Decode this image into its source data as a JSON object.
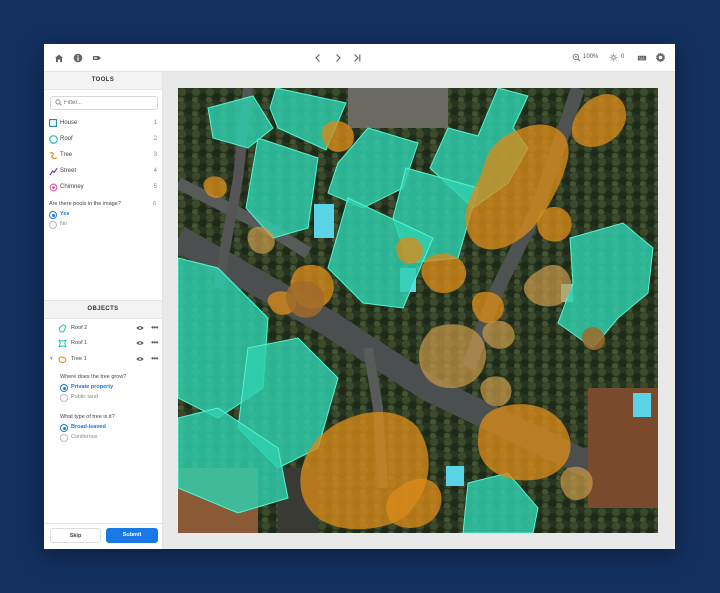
{
  "toolbar": {
    "zoom": "100%",
    "brightness": "0"
  },
  "tools": {
    "header": "TOOLS",
    "filter_placeholder": "Filter...",
    "items": [
      {
        "label": "House",
        "key": "1",
        "color": "#1a7fc1"
      },
      {
        "label": "Roof",
        "key": "2",
        "color": "#27c3b2"
      },
      {
        "label": "Tree",
        "key": "3",
        "color": "#e08a1e"
      },
      {
        "label": "Street",
        "key": "4",
        "color": "#7b3fb5"
      },
      {
        "label": "Chimney",
        "key": "5",
        "color": "#e0519a"
      }
    ],
    "question": {
      "text": "Are there pools in the image?",
      "key": "6",
      "options": [
        "Yes",
        "No"
      ],
      "selected": "Yes"
    }
  },
  "objects": {
    "header": "OBJECTS",
    "items": [
      {
        "label": "Roof 2"
      },
      {
        "label": "Roof 1"
      },
      {
        "label": "Tree 1"
      }
    ],
    "tree_questions": [
      {
        "text": "Where does the tree grow?",
        "options": [
          "Private property",
          "Public land"
        ],
        "selected": "Private property"
      },
      {
        "text": "What type of tree is it?",
        "options": [
          "Broad-leaved",
          "Coniferous"
        ],
        "selected": "Broad-leaved"
      }
    ]
  },
  "footer": {
    "skip_label": "Skip",
    "submit_label": "Submit"
  },
  "colors": {
    "accent": "#1a78e6",
    "background": "#13305f",
    "roof_overlay": "#2fd1b0",
    "tree_overlay": "#d98a1a"
  }
}
